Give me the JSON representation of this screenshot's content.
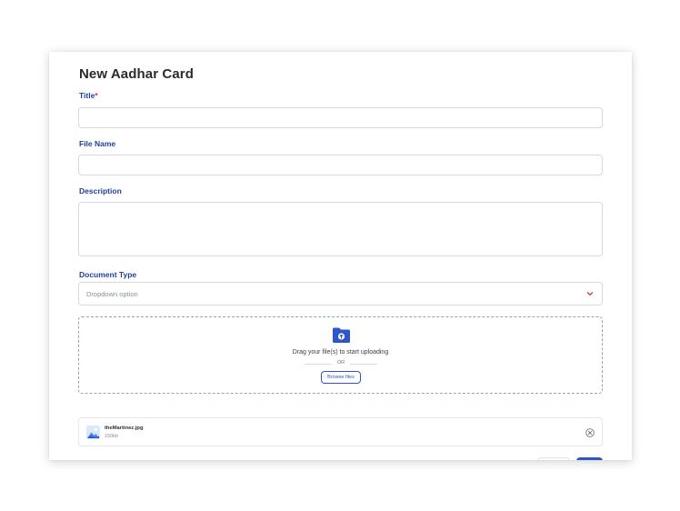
{
  "form": {
    "title": "New Aadhar Card",
    "title_field": {
      "label": "Title",
      "required_mark": "*",
      "value": ""
    },
    "file_name_field": {
      "label": "File Name",
      "value": ""
    },
    "description_field": {
      "label": "Description",
      "value": ""
    },
    "document_type_field": {
      "label": "Document Type",
      "selected": "Dropdown option"
    }
  },
  "upload": {
    "drag_text": "Drag your file(s) to start uploading",
    "or_text": "OR",
    "browse_label": "Browse files"
  },
  "file": {
    "name": "theMartinez.jpg",
    "size": "150kb"
  },
  "colors": {
    "label": "#1f3fa3",
    "accent": "#2c56c9",
    "required": "#d32f2f"
  }
}
